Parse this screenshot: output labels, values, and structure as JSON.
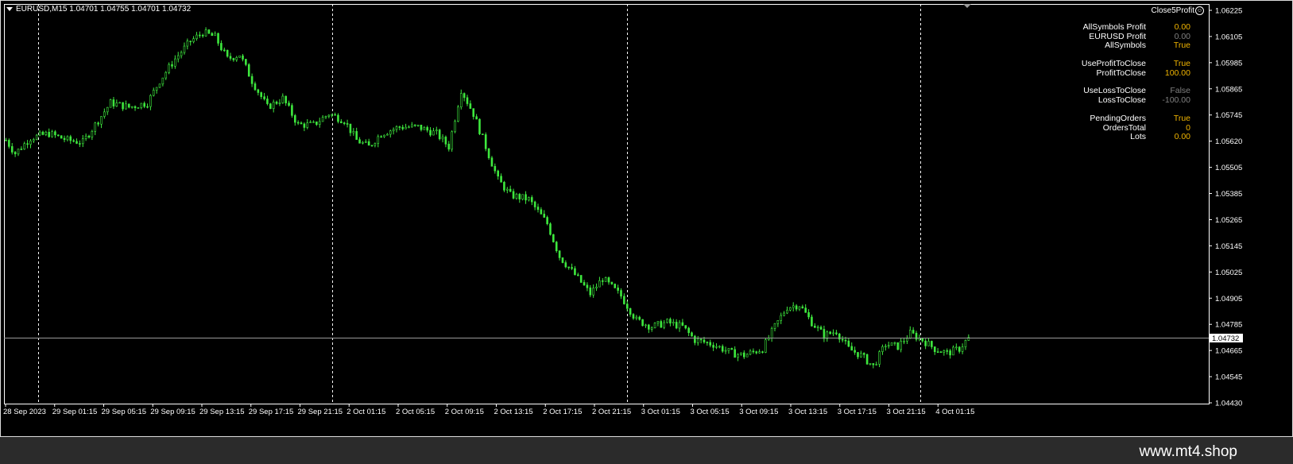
{
  "header": {
    "symbol_line": "EURUSD,M15  1.04701 1.04755 1.04701 1.04732",
    "ea_name": "Close5Profit",
    "ea_icon": "smiley-icon"
  },
  "info_panel": [
    {
      "label": "AllSymbols Profit",
      "value": "0.00",
      "color": "#f0b400",
      "gap": false
    },
    {
      "label": "EURUSD Profit",
      "value": "0.00",
      "color": "#808080",
      "gap": false
    },
    {
      "label": "AllSymbols",
      "value": "True",
      "color": "#f0b400",
      "gap": false
    },
    {
      "label": "UseProfitToClose",
      "value": "True",
      "color": "#f0b400",
      "gap": true
    },
    {
      "label": "ProfitToClose",
      "value": "100.00",
      "color": "#f0b400",
      "gap": false
    },
    {
      "label": "UseLossToClose",
      "value": "False",
      "color": "#808080",
      "gap": true
    },
    {
      "label": "LossToClose",
      "value": "-100.00",
      "color": "#808080",
      "gap": false
    },
    {
      "label": "PendingOrders",
      "value": "True",
      "color": "#f0b400",
      "gap": true
    },
    {
      "label": "OrdersTotal",
      "value": "0",
      "color": "#f0b400",
      "gap": false
    },
    {
      "label": "Lots",
      "value": "0.00",
      "color": "#f0b400",
      "gap": false
    }
  ],
  "watermark": "www.mt4.shop",
  "colors": {
    "background": "#000000",
    "candle": "#3ee83e",
    "grid": "#ffffff",
    "axis_text": "#ffffff",
    "price_line": "#9a9a9a",
    "price_tag_bg": "#ffffff",
    "price_tag_text": "#000000"
  },
  "chart_data": {
    "type": "candlestick",
    "symbol": "EURUSD",
    "timeframe": "M15",
    "last_price": "1.04732",
    "ylim": [
      1.0443,
      1.0625
    ],
    "y_ticks": [
      "1.06225",
      "1.06105",
      "1.05985",
      "1.05865",
      "1.05745",
      "1.05620",
      "1.05505",
      "1.05385",
      "1.05265",
      "1.05145",
      "1.05025",
      "1.04905",
      "1.04785",
      "1.04665",
      "1.04545",
      "1.04430"
    ],
    "x_ticks": [
      "28 Sep 2023",
      "29 Sep 01:15",
      "29 Sep 05:15",
      "29 Sep 09:15",
      "29 Sep 13:15",
      "29 Sep 17:15",
      "29 Sep 21:15",
      "2 Oct 01:15",
      "2 Oct 05:15",
      "2 Oct 09:15",
      "2 Oct 13:15",
      "2 Oct 17:15",
      "2 Oct 21:15",
      "3 Oct 01:15",
      "3 Oct 05:15",
      "3 Oct 09:15",
      "3 Oct 13:15",
      "3 Oct 17:15",
      "3 Oct 21:15",
      "4 Oct 01:15"
    ],
    "day_separators": [
      "29 Sep 00:00",
      "2 Oct 00:00",
      "3 Oct 00:00",
      "4 Oct 00:00"
    ],
    "price_anchors": [
      [
        0,
        1.0563
      ],
      [
        3,
        1.0557
      ],
      [
        8,
        1.0564
      ],
      [
        14,
        1.0566
      ],
      [
        20,
        1.0563
      ],
      [
        25,
        1.0562
      ],
      [
        30,
        1.0572
      ],
      [
        34,
        1.058
      ],
      [
        40,
        1.0578
      ],
      [
        46,
        1.058
      ],
      [
        50,
        1.059
      ],
      [
        55,
        1.06
      ],
      [
        60,
        1.0608
      ],
      [
        64,
        1.0612
      ],
      [
        68,
        1.061
      ],
      [
        72,
        1.06
      ],
      [
        76,
        1.0602
      ],
      [
        80,
        1.059
      ],
      [
        85,
        1.0578
      ],
      [
        90,
        1.0582
      ],
      [
        95,
        1.057
      ],
      [
        100,
        1.057
      ],
      [
        105,
        1.0575
      ],
      [
        110,
        1.0572
      ],
      [
        114,
        1.0563
      ],
      [
        118,
        1.056
      ],
      [
        122,
        1.0566
      ],
      [
        128,
        1.0569
      ],
      [
        134,
        1.0569
      ],
      [
        140,
        1.0566
      ],
      [
        144,
        1.056
      ],
      [
        148,
        1.0586
      ],
      [
        152,
        1.0575
      ],
      [
        156,
        1.056
      ],
      [
        160,
        1.0545
      ],
      [
        164,
        1.0538
      ],
      [
        170,
        1.0536
      ],
      [
        176,
        1.0525
      ],
      [
        180,
        1.051
      ],
      [
        186,
        1.05
      ],
      [
        190,
        1.0493
      ],
      [
        194,
        1.05
      ],
      [
        200,
        1.0492
      ],
      [
        205,
        1.0481
      ],
      [
        210,
        1.0478
      ],
      [
        215,
        1.048
      ],
      [
        220,
        1.0478
      ],
      [
        224,
        1.0472
      ],
      [
        230,
        1.047
      ],
      [
        236,
        1.0466
      ],
      [
        240,
        1.0465
      ],
      [
        246,
        1.0468
      ],
      [
        250,
        1.0478
      ],
      [
        254,
        1.0487
      ],
      [
        258,
        1.0488
      ],
      [
        262,
        1.048
      ],
      [
        266,
        1.0474
      ],
      [
        270,
        1.0476
      ],
      [
        274,
        1.0468
      ],
      [
        278,
        1.0465
      ],
      [
        282,
        1.046
      ],
      [
        286,
        1.047
      ],
      [
        290,
        1.0469
      ],
      [
        294,
        1.0475
      ],
      [
        298,
        1.0472
      ],
      [
        302,
        1.0468
      ],
      [
        306,
        1.0466
      ],
      [
        310,
        1.0468
      ],
      [
        313,
        1.0473
      ]
    ]
  }
}
